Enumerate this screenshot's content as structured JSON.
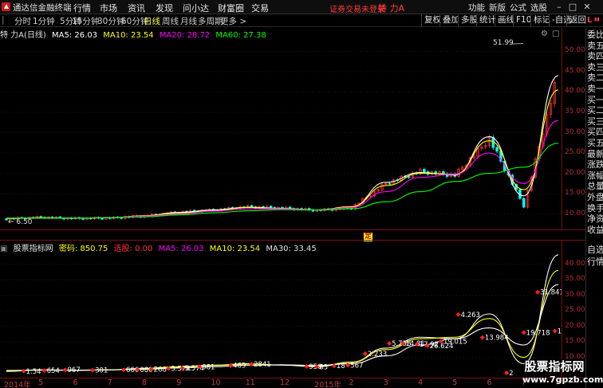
{
  "app": {
    "title": "通达信金融终端"
  },
  "menu": [
    {
      "label": "行情"
    },
    {
      "label": "市场"
    },
    {
      "label": "资讯"
    },
    {
      "label": "发现"
    },
    {
      "label": "问小达"
    },
    {
      "label": "财富圈"
    },
    {
      "label": "交易"
    }
  ],
  "status": {
    "login": "证券交易未登录",
    "stock": "特 力A"
  },
  "top_right": [
    {
      "label": "功能"
    },
    {
      "label": "新版"
    },
    {
      "label": "公式"
    },
    {
      "label": "选股"
    }
  ],
  "toolbar": {
    "periods": [
      {
        "label": "分时"
      },
      {
        "label": "1分钟"
      },
      {
        "label": "5分钟"
      },
      {
        "label": "15分钟"
      },
      {
        "label": "30分钟"
      },
      {
        "label": "60分钟"
      },
      {
        "label": "日线"
      },
      {
        "label": "周线"
      },
      {
        "label": "月线"
      },
      {
        "label": "多周期"
      },
      {
        "label": "更多 >"
      }
    ],
    "right_buttons": [
      {
        "label": "复权"
      },
      {
        "label": "叠加"
      },
      {
        "label": "多股"
      },
      {
        "label": "统计"
      },
      {
        "label": "画线"
      },
      {
        "label": "F10"
      },
      {
        "label": "标记"
      },
      {
        "label": "-自选"
      },
      {
        "label": "返回"
      }
    ]
  },
  "main_header": {
    "name": "特 力A",
    "period": "(日线)",
    "ma5": "MA5: 26.03",
    "ma10": "MA10: 23.54",
    "ma20": "MA20: 28.72",
    "ma60": "MA60: 27.38"
  },
  "main_axis": [
    "50.00",
    "45.00",
    "40.00",
    "35.00",
    "30.00",
    "25.00",
    "20.00",
    "15.00",
    "10.00"
  ],
  "peak_label": "51.99",
  "low_label": "6.50",
  "ding_marker": "定",
  "sub_header": {
    "name": "股票指标网",
    "code": "密码: 850.75",
    "buy": "选股: 0.00",
    "ma5": "MA5: 26.03",
    "ma10": "MA10: 23.54",
    "ma30": "MA30: 33.45"
  },
  "sub_axis": [
    "40.00",
    "35.00",
    "30.00",
    "25.00",
    "20.00",
    "15.00",
    "10.00"
  ],
  "sub_labels": [
    "31.841",
    "4.263",
    "13.984",
    "19.718",
    "5.758",
    "17.92",
    "26.624",
    "19.015",
    "2.233",
    "14",
    "2"
  ],
  "dates": [
    "2014年",
    "5",
    "6",
    "7",
    "8",
    "9",
    "10",
    "11",
    "12",
    "2015年",
    "2",
    "3",
    "4",
    "5",
    "6",
    "7",
    "8"
  ],
  "side_panel": [
    "委比",
    "卖五",
    "卖四",
    "卖三",
    "卖二",
    "卖一",
    "买一",
    "买二",
    "买三",
    "买四",
    "买五",
    "最新",
    "涨跌",
    "涨幅",
    "总量",
    "外盘",
    "换手",
    "净资",
    "收益"
  ],
  "side_panel_lower": [
    "自选",
    "行情"
  ],
  "watermark": {
    "cn": "股票指标网",
    "url": "www.7gpzb.com"
  },
  "colors": {
    "ma5": "#ffffff",
    "ma10": "#ffff00",
    "ma20": "#ff00ff",
    "ma60": "#00ff00",
    "up": "#ff3232",
    "down": "#00ffff"
  },
  "chart_data": [
    {
      "type": "line",
      "title": "特 力A (日线)",
      "xlabel": "",
      "ylabel": "",
      "ylim": [
        7,
        53
      ],
      "categories": [
        "2014年",
        "5",
        "6",
        "7",
        "8",
        "9",
        "10",
        "11",
        "12",
        "2015年",
        "2",
        "3",
        "4",
        "5",
        "6",
        "7",
        "8"
      ],
      "series": [
        {
          "name": "close",
          "values": [
            8.8,
            9.2,
            8.9,
            9.0,
            9.5,
            10.5,
            11.0,
            11.8,
            11.5,
            10.9,
            11.5,
            17.5,
            20.5,
            19.5,
            28.5,
            12.0,
            45.0
          ]
        },
        {
          "name": "MA5",
          "values": [
            8.9,
            9.1,
            9.0,
            9.1,
            9.6,
            10.4,
            11.0,
            11.7,
            11.4,
            11.0,
            11.8,
            17.8,
            20.2,
            19.6,
            29.0,
            14.5,
            44.0
          ]
        },
        {
          "name": "MA10",
          "values": [
            8.9,
            9.1,
            9.0,
            9.1,
            9.6,
            10.2,
            10.8,
            11.6,
            11.3,
            11.0,
            11.8,
            17.0,
            20.0,
            19.8,
            28.0,
            16.0,
            40.5
          ]
        },
        {
          "name": "MA20",
          "values": [
            9.0,
            9.0,
            9.0,
            9.1,
            9.5,
            10.0,
            10.7,
            11.3,
            11.3,
            11.0,
            11.6,
            15.5,
            19.0,
            19.8,
            25.0,
            17.5,
            33.0
          ]
        },
        {
          "name": "MA60",
          "values": [
            9.0,
            9.0,
            9.0,
            9.1,
            9.3,
            9.8,
            10.3,
            10.8,
            11.1,
            11.0,
            11.3,
            13.0,
            15.5,
            18.0,
            20.0,
            21.5,
            27.4
          ]
        }
      ]
    },
    {
      "type": "line",
      "title": "股票指标网",
      "xlabel": "",
      "ylabel": "",
      "ylim": [
        4,
        44
      ],
      "categories": [
        "2014年",
        "5",
        "6",
        "7",
        "8",
        "9",
        "10",
        "11",
        "12",
        "2015年",
        "2",
        "3",
        "4",
        "5",
        "6",
        "7",
        "8"
      ],
      "series": [
        {
          "name": "MA5",
          "values": [
            5.5,
            6.0,
            5.8,
            6.0,
            6.5,
            7.0,
            7.5,
            8.0,
            7.5,
            7.0,
            8.5,
            13.0,
            16.5,
            16.0,
            24.0,
            8.0,
            43.0
          ]
        },
        {
          "name": "MA10",
          "values": [
            5.6,
            6.0,
            5.9,
            6.0,
            6.4,
            6.9,
            7.4,
            7.9,
            7.6,
            7.2,
            8.4,
            12.5,
            16.0,
            16.5,
            22.5,
            10.0,
            38.0
          ]
        },
        {
          "name": "MA30",
          "values": [
            5.8,
            5.9,
            5.9,
            6.0,
            6.2,
            6.6,
            7.0,
            7.5,
            7.6,
            7.4,
            8.0,
            10.5,
            14.0,
            16.0,
            19.5,
            14.0,
            33.45
          ]
        }
      ]
    }
  ]
}
